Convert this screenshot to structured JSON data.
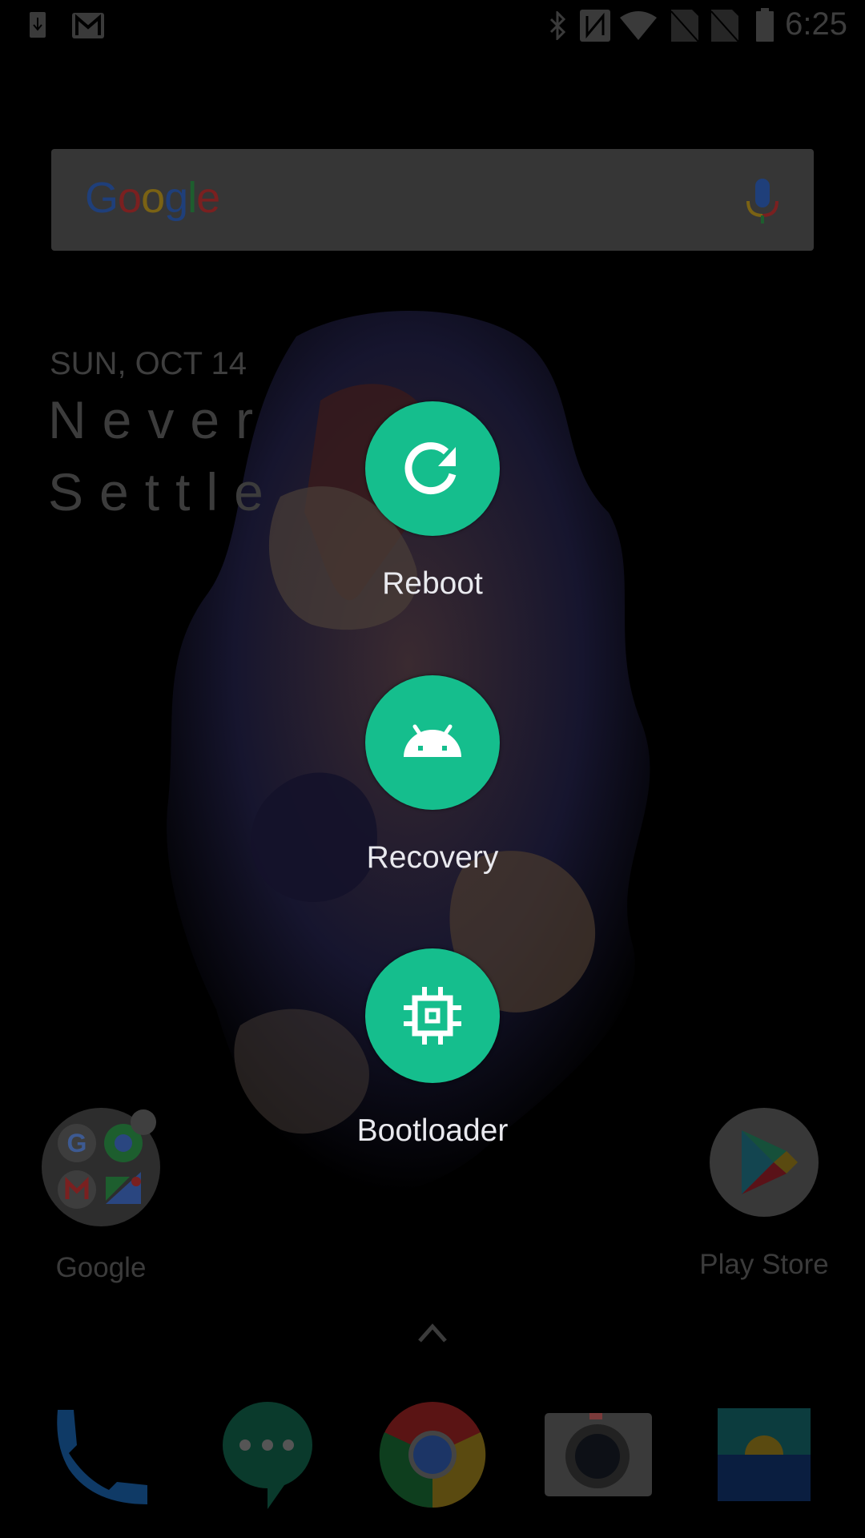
{
  "status_bar": {
    "left_icons": [
      "download-notification-icon",
      "gmail-notification-icon"
    ],
    "right_icons": [
      "bluetooth-icon",
      "nfc-icon",
      "wifi-icon",
      "sim1-no-signal-icon",
      "sim2-no-signal-icon",
      "battery-icon"
    ],
    "time": "6:25"
  },
  "search_widget": {
    "logo_letters": [
      {
        "ch": "G",
        "color": "#1f3f7a"
      },
      {
        "ch": "o",
        "color": "#7a2020"
      },
      {
        "ch": "o",
        "color": "#7a6214"
      },
      {
        "ch": "g",
        "color": "#1f3f7a"
      },
      {
        "ch": "l",
        "color": "#1d5e2e"
      },
      {
        "ch": "e",
        "color": "#7a2020"
      }
    ],
    "mic_icon": "microphone-icon"
  },
  "clock_widget": {
    "date": "SUN, OCT 14",
    "line1": "Never",
    "line2": "Settle"
  },
  "power_menu": {
    "accent_color": "#15be8d",
    "options": [
      {
        "label": "Reboot",
        "icon": "reboot-icon"
      },
      {
        "label": "Recovery",
        "icon": "android-icon"
      },
      {
        "label": "Bootloader",
        "icon": "chip-icon"
      }
    ]
  },
  "home_apps": [
    {
      "label": "Google",
      "icon": "google-folder-icon"
    },
    {
      "label": "Play Store",
      "icon": "play-store-icon"
    }
  ],
  "app_drawer_handle": "chevron-up-icon",
  "dock": [
    {
      "name": "Phone",
      "icon": "phone-icon"
    },
    {
      "name": "Messages",
      "icon": "messages-icon"
    },
    {
      "name": "Chrome",
      "icon": "chrome-icon"
    },
    {
      "name": "Camera",
      "icon": "camera-icon"
    },
    {
      "name": "Gallery",
      "icon": "gallery-icon"
    }
  ]
}
